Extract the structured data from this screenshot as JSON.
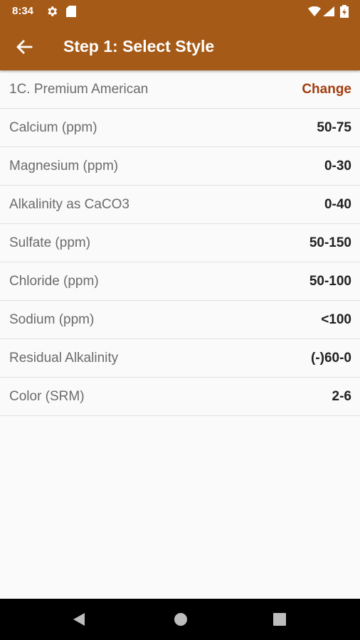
{
  "status": {
    "time": "8:34"
  },
  "app_bar": {
    "title": "Step 1: Select Style",
    "back_icon": "arrow-left-icon"
  },
  "style": {
    "name": "1C. Premium American",
    "change_label": "Change"
  },
  "params": [
    {
      "label": "Calcium (ppm)",
      "value": "50-75"
    },
    {
      "label": "Magnesium (ppm)",
      "value": "0-30"
    },
    {
      "label": "Alkalinity as CaCO3",
      "value": "0-40"
    },
    {
      "label": "Sulfate (ppm)",
      "value": "50-150"
    },
    {
      "label": "Chloride (ppm)",
      "value": "50-100"
    },
    {
      "label": "Sodium (ppm)",
      "value": "<100"
    },
    {
      "label": "Residual Alkalinity",
      "value": "(-)60-0"
    },
    {
      "label": "Color (SRM)",
      "value": "2-6"
    }
  ],
  "colors": {
    "primary": "#a65a17",
    "accent": "#a33d10",
    "background": "#fafafa"
  }
}
